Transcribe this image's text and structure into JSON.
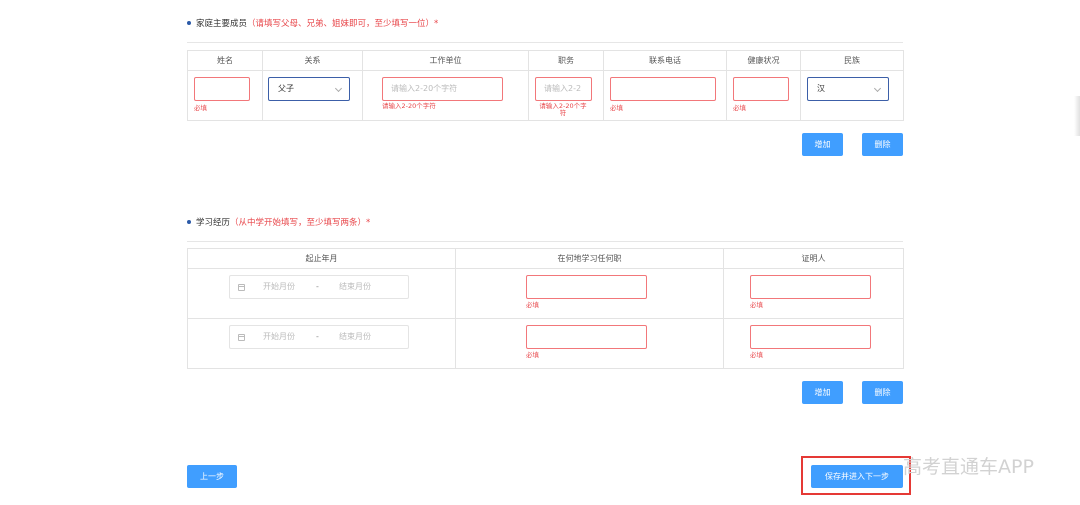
{
  "family": {
    "title": "家庭主要成员",
    "hint": "（请填写父母、兄弟、姐妹即可，至少填写一位）*",
    "headers": [
      "姓名",
      "关系",
      "工作单位",
      "职务",
      "联系电话",
      "健康状况",
      "民族"
    ],
    "row": {
      "name_error": "必填",
      "relation_value": "父子",
      "employer_placeholder": "请输入2-20个字符",
      "employer_error": "请输入2-20个字符",
      "position_placeholder": "请输入2-2",
      "position_error": "请输入2-20个字符",
      "phone_error": "必填",
      "health_error": "必填",
      "ethnicity_value": "汉"
    },
    "add_label": "增加",
    "delete_label": "删除"
  },
  "study": {
    "title": "学习经历",
    "hint": "（从中学开始填写，至少填写两条）*",
    "headers": [
      "起止年月",
      "在何地学习任何职",
      "证明人"
    ],
    "rows": [
      {
        "start_placeholder": "开始月份",
        "separator": "-",
        "end_placeholder": "结束月份",
        "place_error": "必填",
        "witness_error": "必填"
      },
      {
        "start_placeholder": "开始月份",
        "separator": "-",
        "end_placeholder": "结束月份",
        "place_error": "必填",
        "witness_error": "必填"
      }
    ],
    "add_label": "增加",
    "delete_label": "删除"
  },
  "footer": {
    "prev_label": "上一步",
    "next_label": "保存并进入下一步"
  },
  "watermark": "高考直通车APP",
  "colors": {
    "primary": "#409eff",
    "error": "#e8464a",
    "highlight": "#e53935"
  }
}
